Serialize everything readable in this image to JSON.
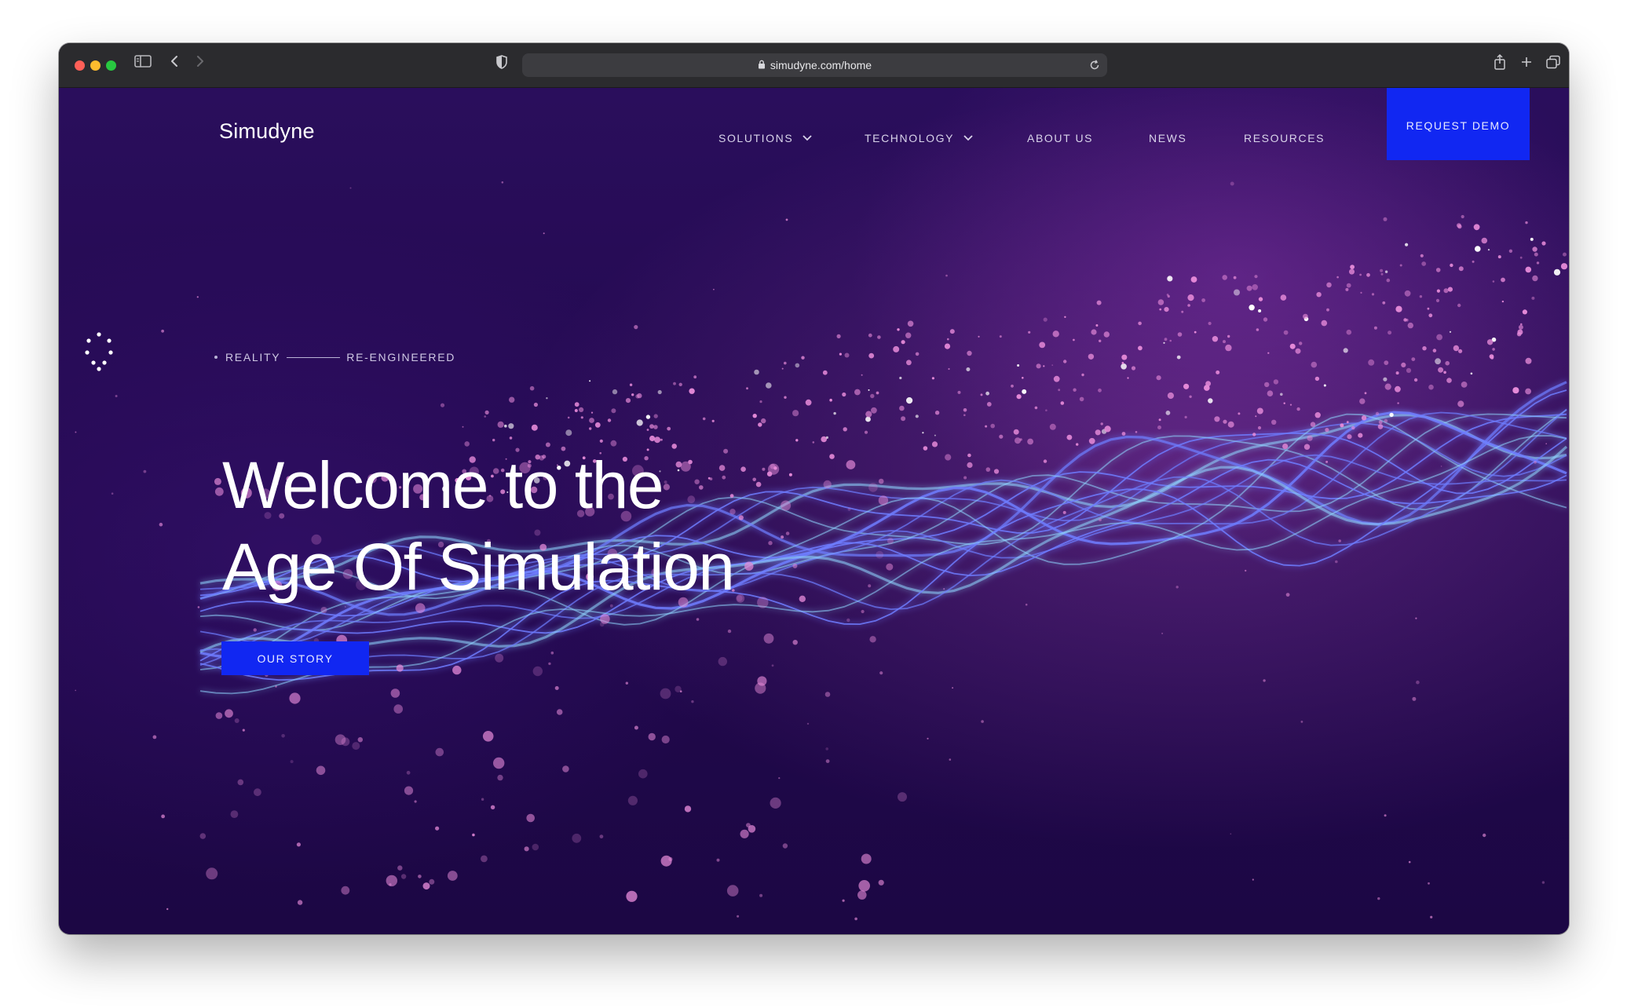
{
  "browser": {
    "url": "simudyne.com/home",
    "traffic_lights": [
      "#ff5f57",
      "#febc2e",
      "#28c840"
    ],
    "icons": [
      "sidebar-icon",
      "back-icon",
      "forward-icon",
      "shield-icon",
      "lock-icon",
      "reload-icon",
      "share-icon",
      "new-tab-icon",
      "tabs-overview-icon"
    ]
  },
  "site": {
    "logo": "Simudyne",
    "nav": [
      {
        "label": "SOLUTIONS",
        "has_dropdown": true
      },
      {
        "label": "TECHNOLOGY",
        "has_dropdown": true
      },
      {
        "label": "ABOUT US",
        "has_dropdown": false
      },
      {
        "label": "NEWS",
        "has_dropdown": false
      },
      {
        "label": "RESOURCES",
        "has_dropdown": false
      }
    ],
    "cta": "REQUEST DEMO",
    "accent": "#1127f2"
  },
  "hero": {
    "tagline_left": "REALITY",
    "tagline_right": "RE-ENGINEERED",
    "title_line1": "Welcome to the",
    "title_line2": "Age Of Simulation",
    "button": "OUR STORY",
    "colors": {
      "background": "#23094f",
      "particles": "#e58ad8",
      "waves": "#6e7dff"
    }
  }
}
